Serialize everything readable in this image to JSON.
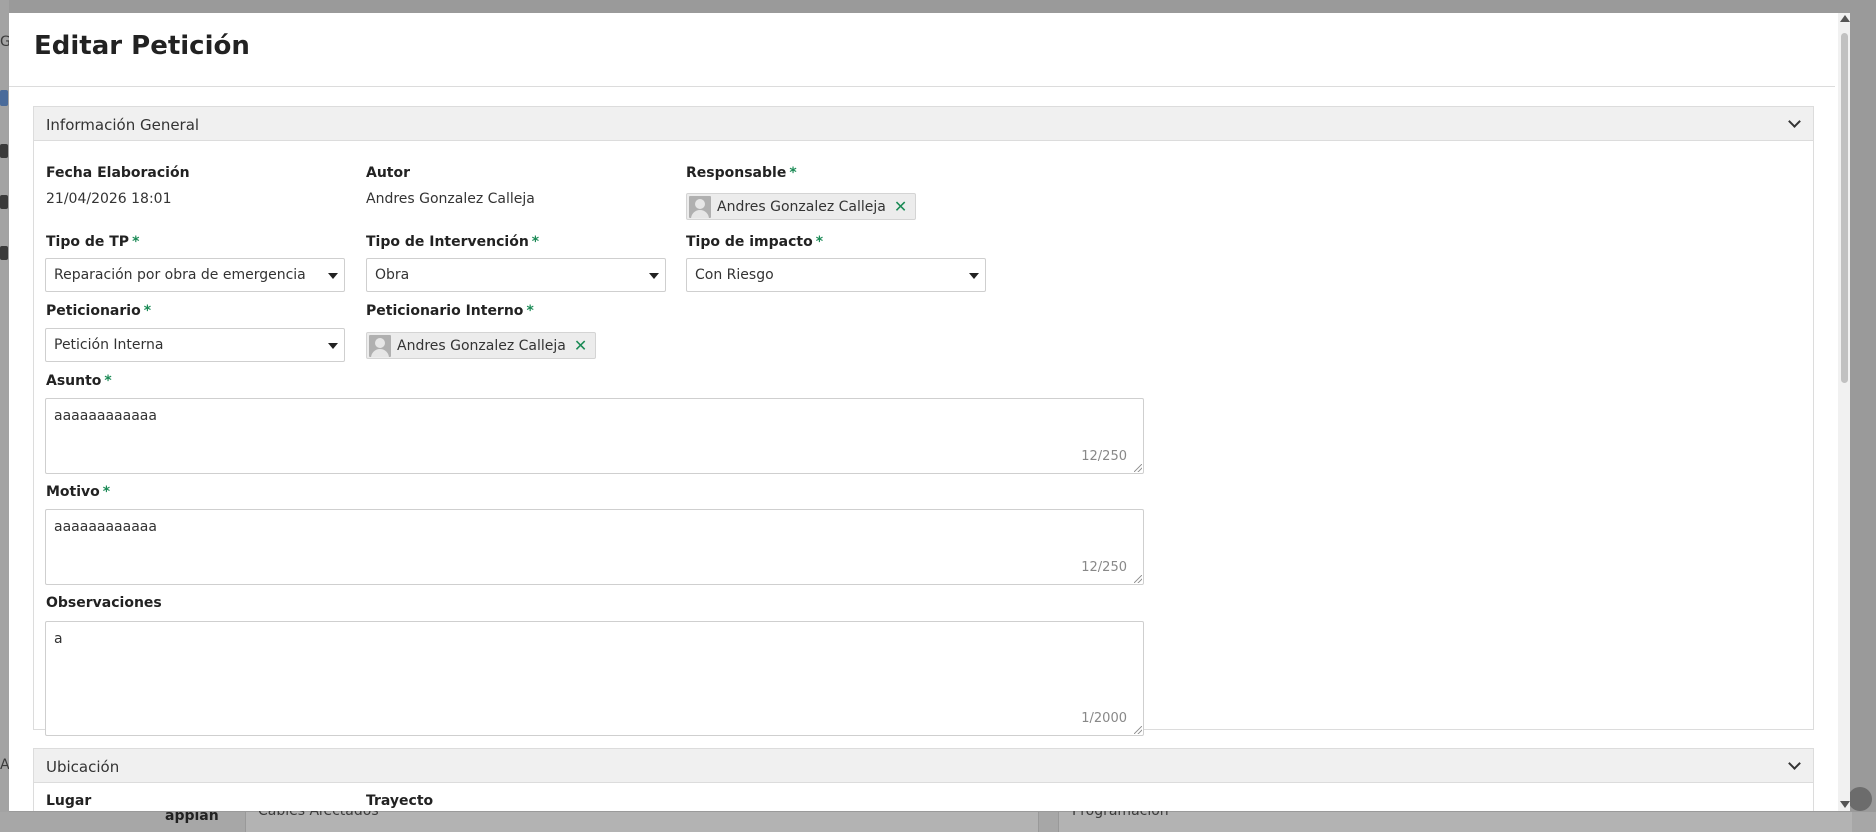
{
  "modal": {
    "title": "Editar Petición"
  },
  "sections": {
    "general": {
      "title": "Información General",
      "fecha": {
        "label": "Fecha Elaboración",
        "value": "21/04/2026 18:01"
      },
      "autor": {
        "label": "Autor",
        "value": "Andres Gonzalez Calleja"
      },
      "responsable": {
        "label": "Responsable",
        "required": "*",
        "user": "Andres Gonzalez Calleja"
      },
      "tipo_tp": {
        "label": "Tipo de TP",
        "required": "*",
        "value": "Reparación por obra de emergencia"
      },
      "tipo_intervencion": {
        "label": "Tipo de Intervención",
        "required": "*",
        "value": "Obra"
      },
      "tipo_impacto": {
        "label": "Tipo de impacto",
        "required": "*",
        "value": "Con Riesgo"
      },
      "peticionario": {
        "label": "Peticionario",
        "required": "*",
        "value": "Petición Interna"
      },
      "peticionario_interno": {
        "label": "Peticionario Interno",
        "required": "*",
        "user": "Andres Gonzalez Calleja"
      },
      "asunto": {
        "label": "Asunto",
        "required": "*",
        "value": "aaaaaaaaaaaa",
        "count": "12/250"
      },
      "motivo": {
        "label": "Motivo",
        "required": "*",
        "value": "aaaaaaaaaaaa",
        "count": "12/250"
      },
      "observaciones": {
        "label": "Observaciones",
        "value": "a",
        "count": "1/2000"
      }
    },
    "ubicacion": {
      "title": "Ubicación",
      "lugar_label": "Lugar",
      "trayecto_label": "Trayecto"
    }
  },
  "background": {
    "logo": "appian",
    "card1": "Cables Afectados",
    "card2": "Programación",
    "left_letters": [
      "Gc",
      "Ac"
    ]
  },
  "colors": {
    "accent": "#1a8a55",
    "section_header": "#f0f0f0"
  }
}
